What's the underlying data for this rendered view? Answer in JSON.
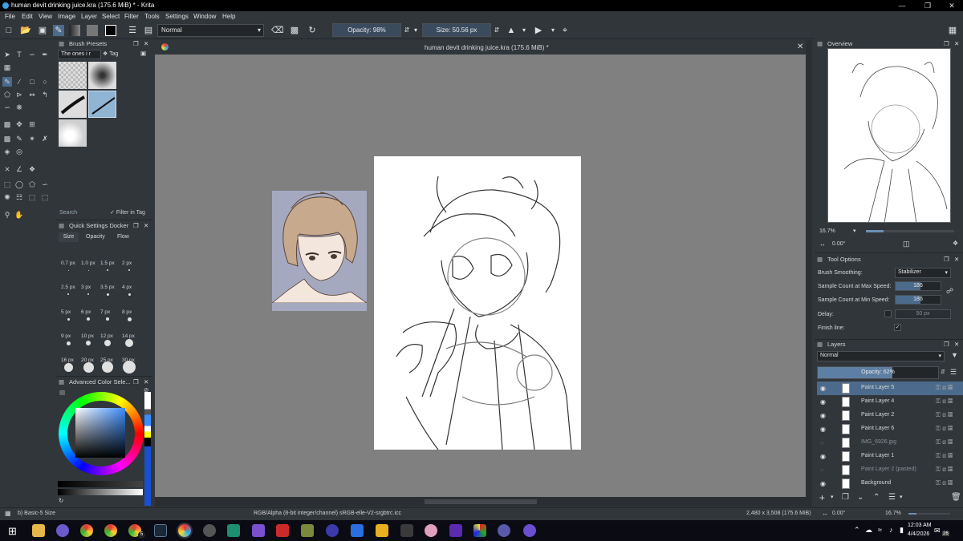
{
  "window": {
    "title": "human devit drinking juice.kra (175.6 MiB) * - Krita"
  },
  "menu": [
    "File",
    "Edit",
    "View",
    "Image",
    "Layer",
    "Select",
    "Filter",
    "Tools",
    "Settings",
    "Window",
    "Help"
  ],
  "toolbar": {
    "blend_mode": "Normal",
    "opacity": "Opacity: 98%",
    "size": "Size: 50.56 px"
  },
  "brush_presets": {
    "title": "Brush Presets",
    "tag_filter": "The ones i r",
    "tag_label": "Tag",
    "search_placeholder": "Search",
    "filter_in_tag": "Filter in Tag"
  },
  "quick_settings": {
    "title": "Quick Settings Docker",
    "tabs": [
      "Size",
      "Opacity",
      "Flow"
    ],
    "sizes": [
      [
        "0.7 px",
        "1.0 px",
        "1.5 px",
        "2 px"
      ],
      [
        "2.5 px",
        "3 px",
        "3.5 px",
        "4 px"
      ],
      [
        "5 px",
        "6 px",
        "7 px",
        "8 px"
      ],
      [
        "9 px",
        "10 px",
        "12 px",
        "14 px"
      ],
      [
        "16 px",
        "20 px",
        "25 px",
        "30 px"
      ]
    ]
  },
  "color_selector": {
    "title": "Advanced Color Sele..."
  },
  "document": {
    "tab_title": "human devit drinking juice.kra (175.6 MiB) *"
  },
  "overview": {
    "title": "Overview",
    "zoom": "16.7%",
    "rotation": "0.00°"
  },
  "tool_options": {
    "title": "Tool Options",
    "brush_smoothing_label": "Brush Smoothing:",
    "brush_smoothing_value": "Stabilizer",
    "max_speed_label": "Sample Count at Max Speed:",
    "max_speed_value": "186",
    "min_speed_label": "Sample Count at Min Speed:",
    "min_speed_value": "186",
    "delay_label": "Delay:",
    "delay_value": "50 px",
    "finish_line_label": "Finish line:"
  },
  "layers": {
    "title": "Layers",
    "blend_mode": "Normal",
    "opacity": "Opacity: 62%",
    "items": [
      {
        "name": "Paint Layer 5",
        "selected": true,
        "visible": true
      },
      {
        "name": "Paint Layer 4",
        "visible": true
      },
      {
        "name": "Paint Layer 2",
        "visible": true
      },
      {
        "name": "Paint Layer 6",
        "visible": true
      },
      {
        "name": "IMG_6926.jpg",
        "visible": false
      },
      {
        "name": "Paint Layer 1",
        "visible": true
      },
      {
        "name": "Paint Layer 2 (pasted)",
        "visible": false
      },
      {
        "name": "Background",
        "visible": true
      }
    ]
  },
  "status": {
    "brush": "b) Basic-5 Size",
    "color_info": "RGB/Alpha (8-bit integer/channel)  sRGB-elle-V2-srgbtrc.icc",
    "dimensions": "2,480 x 3,508 (175.6 MiB)",
    "rotation": "0.00°",
    "zoom": "16.7%"
  },
  "taskbar": {
    "time": "12:03 AM",
    "date": "4/4/2026",
    "badge_count": "26",
    "steam_badge": "5"
  },
  "colors": {
    "panel": "#31363b",
    "canvas_bg": "#808080",
    "accent": "#4c6b8c"
  }
}
